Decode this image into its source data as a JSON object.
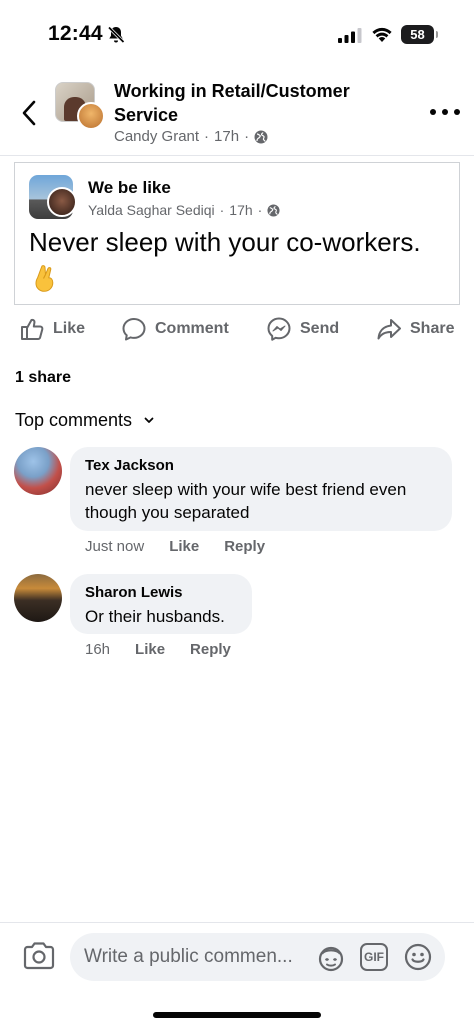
{
  "status_bar": {
    "time": "12:44",
    "battery": "58"
  },
  "header": {
    "group_name": "Working in Retail/Customer Service",
    "author": "Candy Grant",
    "time": "17h"
  },
  "shared_post": {
    "title": "We be like",
    "author": "Yalda Saghar Sediqi",
    "time": "17h",
    "body": "Never sleep with your co-workers."
  },
  "actions": {
    "like": "Like",
    "comment": "Comment",
    "send": "Send",
    "share": "Share"
  },
  "shares_count": "1 share",
  "comments_filter": "Top comments",
  "comments": [
    {
      "name": "Tex Jackson",
      "text": "never sleep with your wife best friend even though you separated",
      "time": "Just now",
      "like": "Like",
      "reply": "Reply"
    },
    {
      "name": "Sharon Lewis",
      "text": "Or their husbands.",
      "time": "16h",
      "like": "Like",
      "reply": "Reply"
    }
  ],
  "composer": {
    "placeholder": "Write a public commen...",
    "gif_label": "GIF"
  },
  "colors": {
    "text_primary": "#050505",
    "text_secondary": "#65676b",
    "bubble_bg": "#f0f2f5"
  }
}
